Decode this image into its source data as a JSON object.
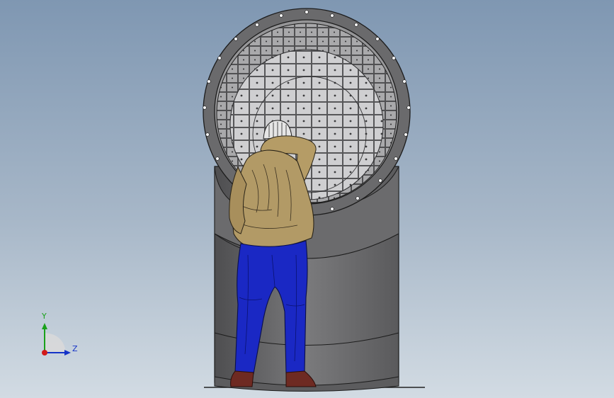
{
  "triad": {
    "y_label": "Y",
    "z_label": "Z",
    "colors": {
      "y": "#1aa11a",
      "z": "#1533c8",
      "x": "#d21a1a"
    }
  },
  "scene": {
    "background_top": "#7f97b2",
    "background_bottom": "#d2dbe3",
    "pipe_color": "#6e6e70",
    "flange_color": "#6a6a6c",
    "tile_color": "#c9c9cb",
    "shirt_color": "#b29a66",
    "jeans_color": "#1a28c4",
    "boots_color": "#6e2a22",
    "icons": [
      "pipe-elbow-model-icon",
      "worker-figure-icon",
      "view-triad-icon"
    ]
  }
}
